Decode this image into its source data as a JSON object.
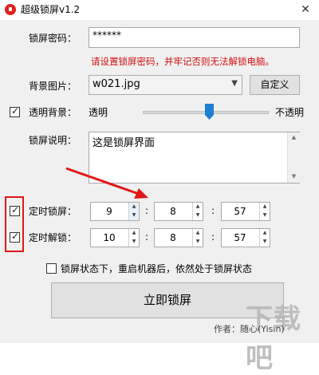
{
  "window": {
    "title": "超级锁屏v1.2",
    "close_glyph": "✕",
    "icon": "app-lock-icon"
  },
  "form": {
    "password_label": "锁屏密码：",
    "password_value": "******",
    "warning": "请设置锁屏密码，并牢记否则无法解锁电脑。",
    "bg_label": "背景图片：",
    "bg_value": "w021.jpg",
    "custom_button": "自定义",
    "transparent_label": "透明背景：",
    "transparent_checked": true,
    "slider_left": "透明",
    "slider_right": "不透明",
    "desc_label": "锁屏说明：",
    "desc_value": "这是锁屏界面"
  },
  "timers": {
    "lock": {
      "label": "定时锁屏：",
      "checked": true,
      "hour": "9",
      "minute": "8",
      "second": "57"
    },
    "unlock": {
      "label": "定时解锁：",
      "checked": true,
      "hour": "10",
      "minute": "8",
      "second": "57"
    },
    "colon": ":"
  },
  "reboot_option": {
    "label": "锁屏状态下，重启机器后，依然处于锁屏状态",
    "checked": false
  },
  "lock_now_button": "立即锁屏",
  "author": "作者：随心(Yisin)",
  "watermark": "下载吧",
  "colors": {
    "warning": "#d01010",
    "annotation": "#e01818",
    "slider_thumb": "#1e7fd6"
  }
}
